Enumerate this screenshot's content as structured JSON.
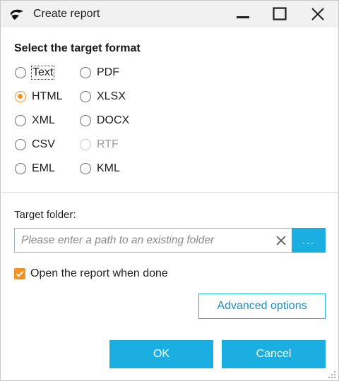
{
  "window": {
    "title": "Create report",
    "app_icon": "app-logo-icon",
    "controls": {
      "minimize": "minimize-icon",
      "maximize": "maximize-icon",
      "close": "close-icon"
    }
  },
  "format": {
    "heading": "Select the target format",
    "selected": "HTML",
    "options": [
      {
        "label": "Text",
        "checked": false,
        "disabled": false
      },
      {
        "label": "PDF",
        "checked": false,
        "disabled": false
      },
      {
        "label": "HTML",
        "checked": true,
        "disabled": false
      },
      {
        "label": "XLSX",
        "checked": false,
        "disabled": false
      },
      {
        "label": "XML",
        "checked": false,
        "disabled": false
      },
      {
        "label": "DOCX",
        "checked": false,
        "disabled": false
      },
      {
        "label": "CSV",
        "checked": false,
        "disabled": false
      },
      {
        "label": "RTF",
        "checked": false,
        "disabled": true
      },
      {
        "label": "EML",
        "checked": false,
        "disabled": false
      },
      {
        "label": "KML",
        "checked": false,
        "disabled": false
      }
    ]
  },
  "folder": {
    "label": "Target folder:",
    "value": "",
    "placeholder": "Please enter a path to an existing folder",
    "clear_icon": "clear-icon",
    "browse_label": "..."
  },
  "open_when_done": {
    "label": "Open the report when done",
    "checked": true
  },
  "buttons": {
    "advanced": "Advanced options",
    "ok": "OK",
    "cancel": "Cancel"
  },
  "colors": {
    "accent": "#1aafe0",
    "selection": "#f29222",
    "titlebar": "#f1f1f1"
  }
}
